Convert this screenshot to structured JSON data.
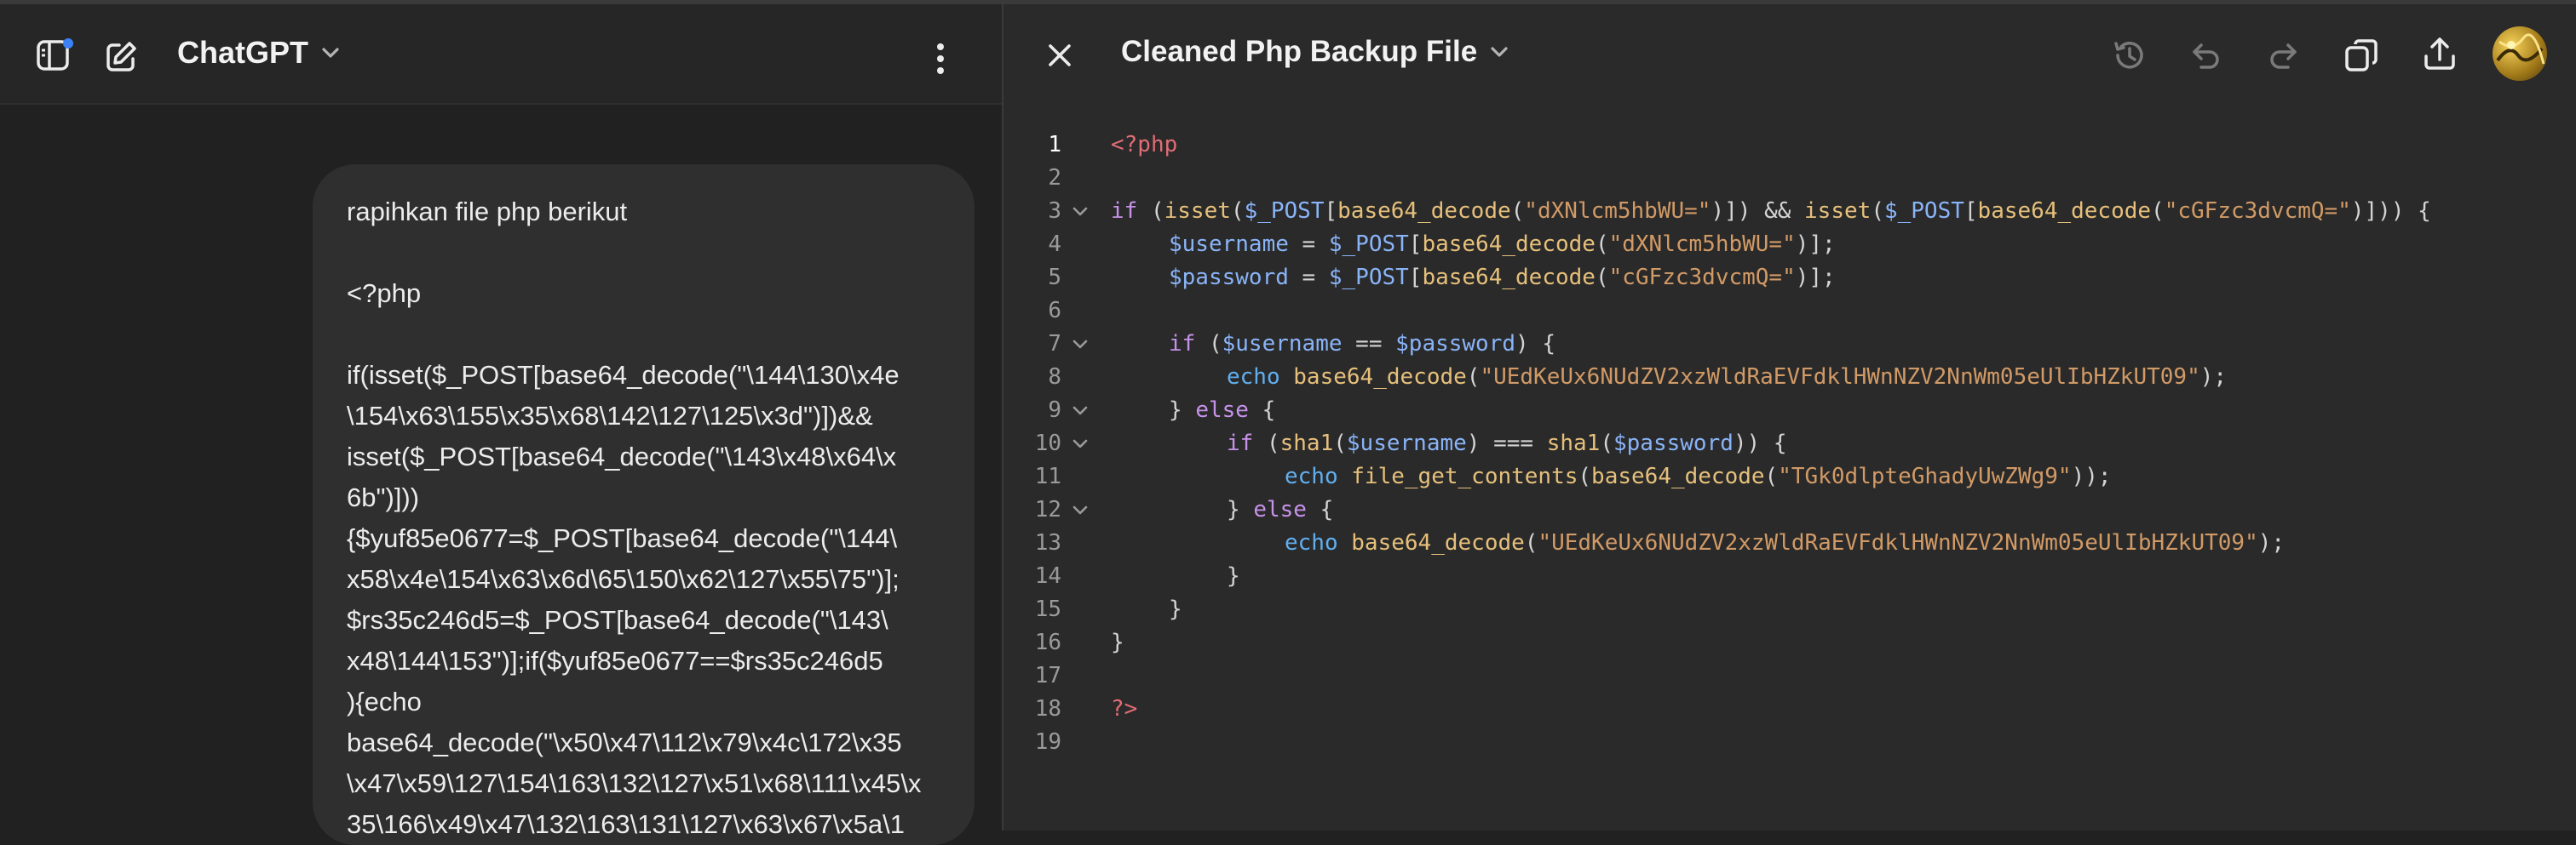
{
  "app": {
    "title": "ChatGPT"
  },
  "message": {
    "text": "rapihkan file php berikut\n\n<?php\n\nif(isset($_POST[base64_decode(\"\\144\\130\\x4e\n\\154\\x63\\155\\x35\\x68\\142\\127\\125\\x3d\")])&&\nisset($_POST[base64_decode(\"\\143\\x48\\x64\\x\n6b\")]))\n{$yuf85e0677=$_POST[base64_decode(\"\\144\\\nx58\\x4e\\154\\x63\\x6d\\65\\150\\x62\\127\\x55\\75\")];\n$rs35c246d5=$_POST[base64_decode(\"\\143\\\nx48\\144\\153\")];if($yuf85e0677==$rs35c246d5\n){echo\nbase64_decode(\"\\x50\\x47\\112\\x79\\x4c\\172\\x35\n\\x47\\x59\\127\\154\\163\\132\\127\\x51\\x68\\111\\x45\\x\n35\\166\\x49\\x47\\132\\163\\131\\127\\x63\\x67\\x5a\\1"
  },
  "document": {
    "title": "Cleaned Php Backup File"
  },
  "code": {
    "line_numbers": [
      "1",
      "2",
      "3",
      "4",
      "5",
      "6",
      "7",
      "8",
      "9",
      "10",
      "11",
      "12",
      "13",
      "14",
      "15",
      "16",
      "17",
      "18",
      "19"
    ],
    "l1_open": "<?php",
    "l3_if": "if",
    "l3_a": " (",
    "l3_isset1": "isset",
    "l3_b": "(",
    "l3_post1": "$_POST",
    "l3_c": "[",
    "l3_b64a": "base64_decode",
    "l3_d": "(",
    "l3_s1": "\"dXNlcm5hbWU=\"",
    "l3_e": ")]) && ",
    "l3_isset2": "isset",
    "l3_f": "(",
    "l3_post2": "$_POST",
    "l3_g": "[",
    "l3_b64b": "base64_decode",
    "l3_h": "(",
    "l3_s2": "\"cGFzc3dvcmQ=\"",
    "l3_i": ")])) {",
    "l4_var": "$username",
    "l4_a": " = ",
    "l4_post": "$_POST",
    "l4_b": "[",
    "l4_b64": "base64_decode",
    "l4_c": "(",
    "l4_s": "\"dXNlcm5hbWU=\"",
    "l4_d": ")];",
    "l5_var": "$password",
    "l5_a": " = ",
    "l5_post": "$_POST",
    "l5_b": "[",
    "l5_b64": "base64_decode",
    "l5_c": "(",
    "l5_s": "\"cGFzc3dvcmQ=\"",
    "l5_d": ")];",
    "l7_if": "if",
    "l7_a": " (",
    "l7_v1": "$username",
    "l7_b": " == ",
    "l7_v2": "$password",
    "l7_c": ") {",
    "l8_echo": "echo",
    "l8_b64": "base64_decode",
    "l8_a": "(",
    "l8_s": "\"UEdKeUx6NUdZV2xzWldRaEVFdklHWnNZV2NnWm05eUlIbHZkUT09\"",
    "l8_b": ");",
    "l9_a": "} ",
    "l9_else": "else",
    "l9_b": " {",
    "l10_if": "if",
    "l10_a": " (",
    "l10_sha1": "sha1",
    "l10_b": "(",
    "l10_v1": "$username",
    "l10_c": ") === ",
    "l10_sha2": "sha1",
    "l10_d": "(",
    "l10_v2": "$password",
    "l10_e": ")) {",
    "l11_echo": "echo",
    "l11_fgc": "file_get_contents",
    "l11_a": "(",
    "l11_b64": "base64_decode",
    "l11_b": "(",
    "l11_s": "\"TGk0dlpteGhadyUwZWg9\"",
    "l11_c": "));",
    "l12_a": "} ",
    "l12_else": "else",
    "l12_b": " {",
    "l13_echo": "echo",
    "l13_b64": "base64_decode",
    "l13_a": "(",
    "l13_s": "\"UEdKeUx6NUdZV2xzWldRaEVFdklHWnNZV2NnWm05eUlIbHZkUT09\"",
    "l13_b": ");",
    "l14": "}",
    "l15": "}",
    "l16": "}",
    "l18_close": "?>"
  },
  "colors": {
    "background": "#212121",
    "panel": "#2a2a2a",
    "bubble": "#2f2f2f",
    "keyword": "#c792ea",
    "function": "#e6c07b",
    "variable": "#8ab4f8",
    "string": "#d19a66",
    "notification_dot": "#3b82f6"
  },
  "icons": [
    "sidebar-icon",
    "new-chat-icon",
    "chevron-down-icon",
    "more-vertical-icon",
    "close-icon",
    "history-icon",
    "undo-icon",
    "redo-icon",
    "copy-icon",
    "share-icon",
    "avatar",
    "fold-chevron-icon"
  ]
}
